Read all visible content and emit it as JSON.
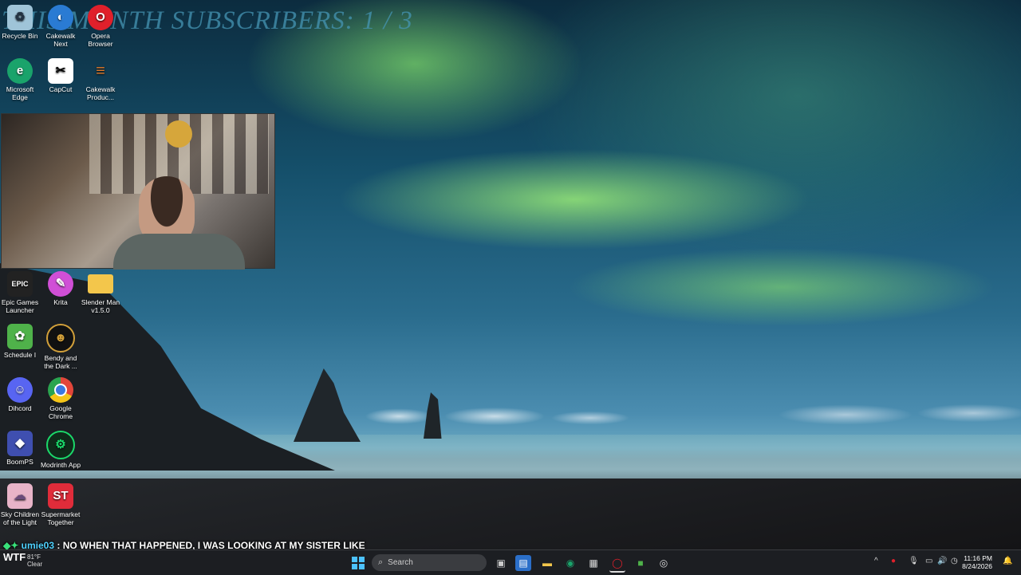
{
  "overlay": {
    "subscribers_text": "THIS MONTH SUBSCRIBERS: 1 / 3"
  },
  "desktop_icons": [
    {
      "label": "Recycle Bin",
      "icon": "recycle-bin-icon",
      "color": "#9fc4d8"
    },
    {
      "label": "Cakewalk Next",
      "icon": "cakewalk-next-icon",
      "color": "#2a7bd3"
    },
    {
      "label": "Opera Browser",
      "icon": "opera-icon",
      "color": "#e0202b"
    },
    {
      "label": "Microsoft Edge",
      "icon": "edge-icon",
      "color": "#1aa36b"
    },
    {
      "label": "CapCut",
      "icon": "capcut-icon",
      "color": "#ffffff"
    },
    {
      "label": "Cakewalk Produc...",
      "icon": "cakewalk-producer-icon",
      "color": "#e07a2a"
    },
    {
      "label": "Epic Games Launcher",
      "icon": "epic-games-icon",
      "color": "#222222"
    },
    {
      "label": "Krita",
      "icon": "krita-icon",
      "color": "#d04fd6"
    },
    {
      "label": "Slender Man v1.5.0",
      "icon": "folder-icon",
      "color": "#f3c64b"
    },
    {
      "label": "Schedule I",
      "icon": "schedule-one-icon",
      "color": "#4fb24a"
    },
    {
      "label": "Bendy and the Dark ...",
      "icon": "bendy-icon",
      "color": "#d2a03a"
    },
    {
      "label": "Dihcord",
      "icon": "discord-icon",
      "color": "#5865f2"
    },
    {
      "label": "Google Chrome",
      "icon": "chrome-icon",
      "color": "#e2463a"
    },
    {
      "label": "BoomPS",
      "icon": "boomps-icon",
      "color": "#3f4fb0"
    },
    {
      "label": "Modrinth App",
      "icon": "modrinth-icon",
      "color": "#1bd96a"
    },
    {
      "label": "Sky Children of the Light",
      "icon": "sky-icon",
      "color": "#e8b4c8"
    },
    {
      "label": "Supermarket Together",
      "icon": "supermarket-together-icon",
      "color": "#e02c3a"
    }
  ],
  "chat": {
    "user": "umie03",
    "separator": ":",
    "message": "NO WHEN THAT HAPPENED, I WAS LOOKING AT MY SISTER LIKE"
  },
  "taskbar": {
    "weather_temp": "81°F",
    "weather_cond": "Clear",
    "weather_badge": "WTF",
    "search_placeholder": "Search",
    "time": "11:16 PM",
    "date": "8/24/2026"
  }
}
